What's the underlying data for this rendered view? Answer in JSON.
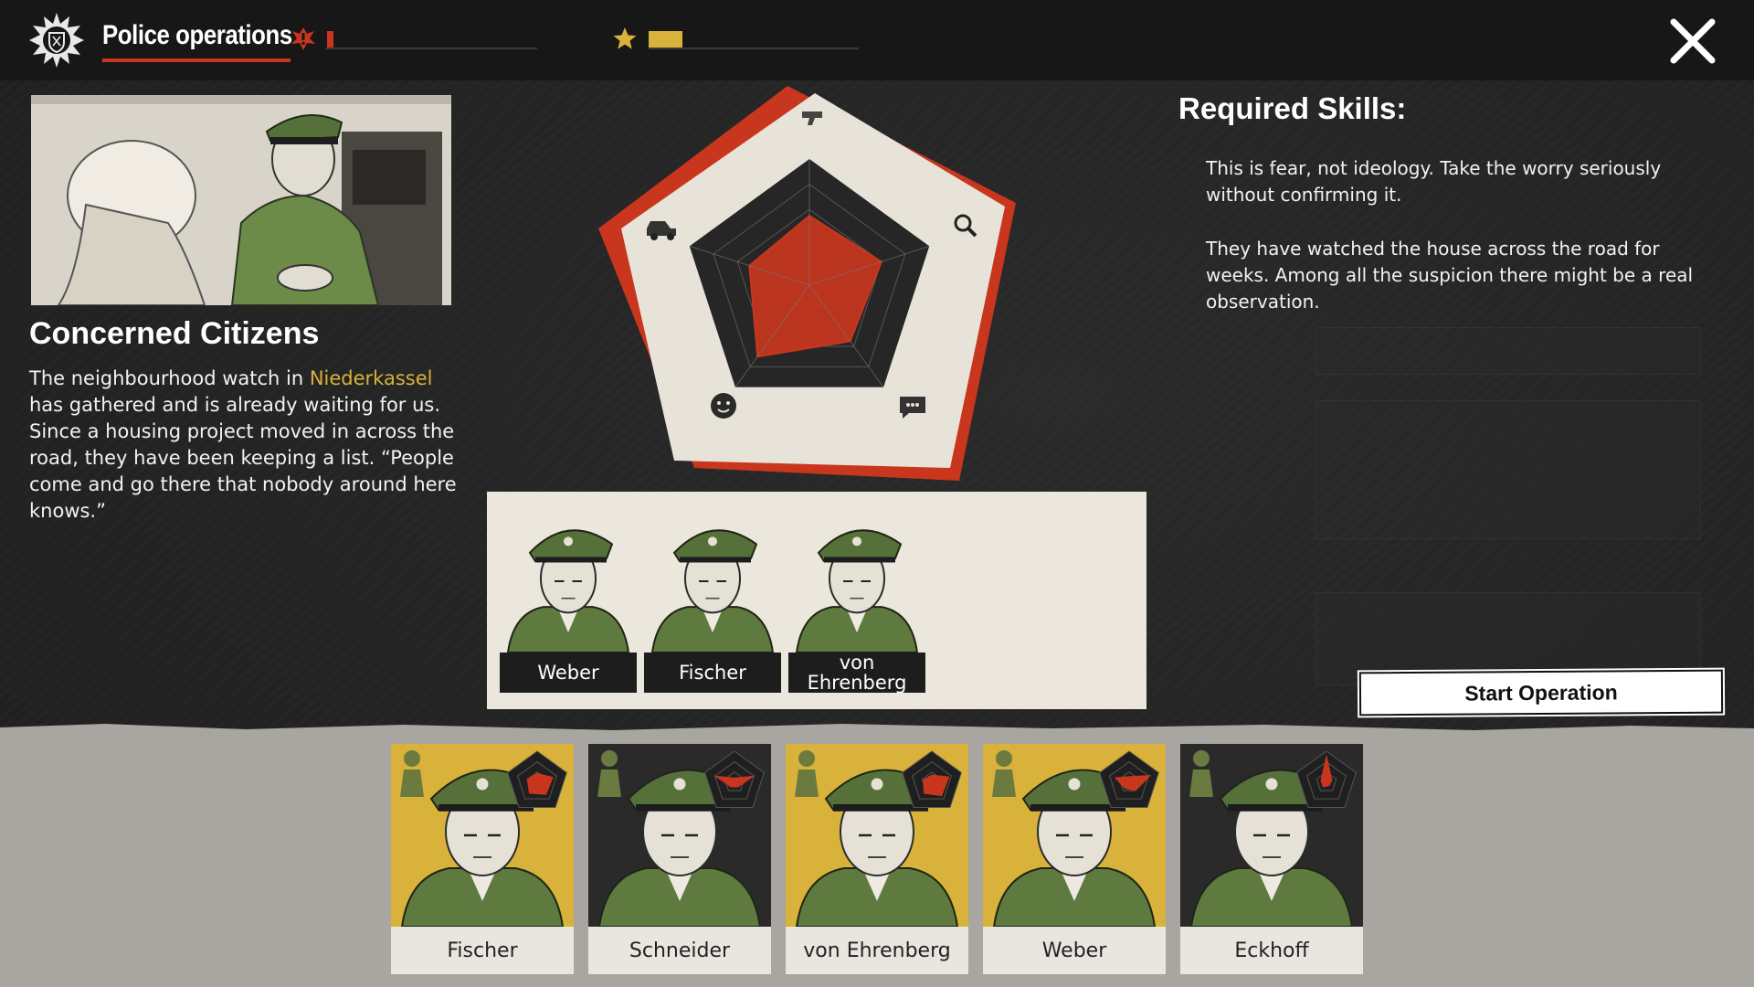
{
  "header": {
    "title": "Police operations",
    "fear_meter": 0.03,
    "reputation_meter": 0.16,
    "icons": [
      "police-emblem-icon",
      "alert-icon",
      "star-icon",
      "close-icon"
    ],
    "colors": {
      "accent_red": "#c8361d",
      "accent_gold": "#d8b23a"
    }
  },
  "case": {
    "title": "Concerned Citizens",
    "desc_pre": "The neighbourhood watch in ",
    "desc_highlight": "Niederkassel",
    "desc_post": " has gathered and is already waiting for us. Since a housing project moved in across the road, they have been keeping a list. “People come and go there that nobody around here knows.”"
  },
  "skills": {
    "title": "Required Skills:",
    "para1": "This is fear, not ideology. Take the worry seriously without confirming it.",
    "para2": "They have watched the house across the road for weeks. Among all the suspicion there might be a real observation.",
    "radar_icons": [
      "pistol-icon",
      "magnifier-icon",
      "speech-icon",
      "face-icon",
      "car-icon"
    ],
    "required_levels": [
      0.55,
      0.6,
      0.55,
      0.7,
      0.5
    ]
  },
  "team": [
    {
      "name": "Weber"
    },
    {
      "name": "Fischer"
    },
    {
      "name": "von Ehrenberg"
    }
  ],
  "start_button": "Start Operation",
  "roster": [
    {
      "name": "Fischer",
      "selected": true
    },
    {
      "name": "Schneider",
      "selected": false
    },
    {
      "name": "von Ehrenberg",
      "selected": true
    },
    {
      "name": "Weber",
      "selected": true
    },
    {
      "name": "Eckhoff",
      "selected": false
    }
  ]
}
